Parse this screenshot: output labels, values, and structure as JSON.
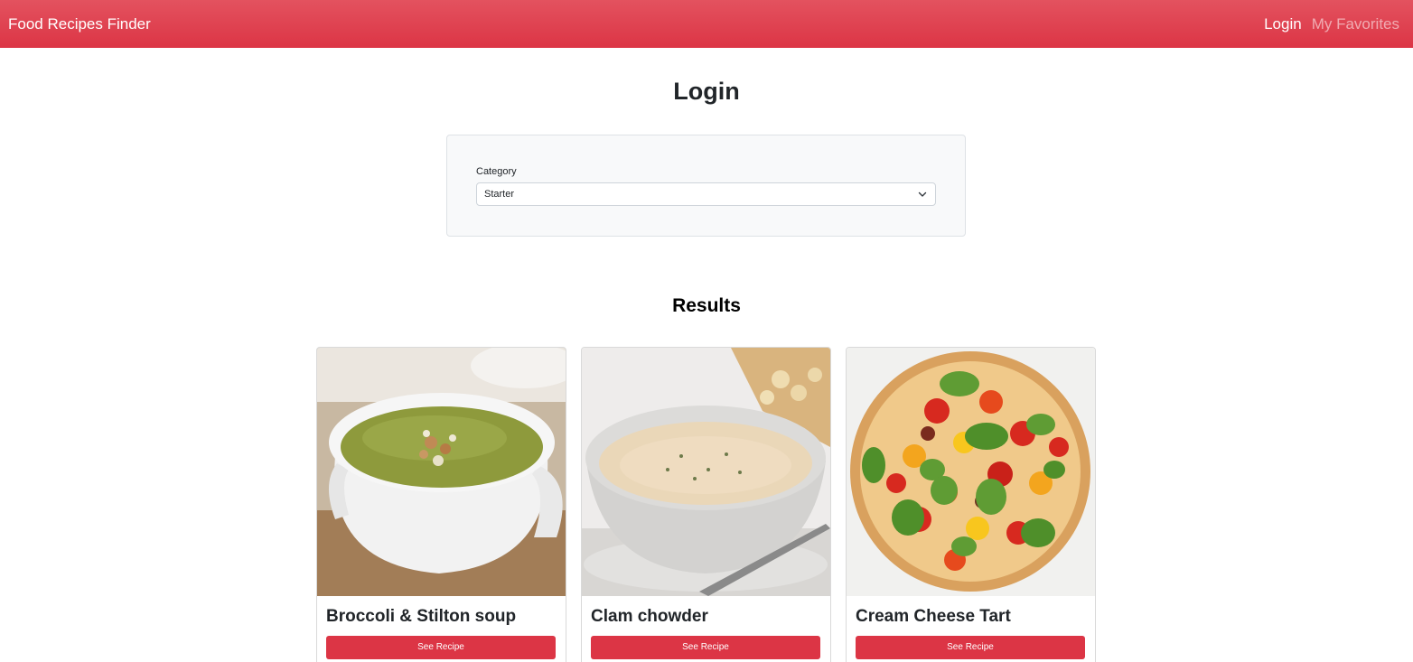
{
  "navbar": {
    "brand": "Food Recipes Finder",
    "links": [
      {
        "label": "Login",
        "active": true
      },
      {
        "label": "My Favorites",
        "active": false
      }
    ],
    "color": "#dc3545"
  },
  "page": {
    "title": "Login",
    "results_title": "Results"
  },
  "filter": {
    "label": "Category",
    "selected": "Starter",
    "icon": "chevron-down-icon"
  },
  "recipes": [
    {
      "title": "Broccoli & Stilton soup",
      "button": "See Recipe",
      "image": "green soup in white bowl"
    },
    {
      "title": "Clam chowder",
      "button": "See Recipe",
      "image": "creamy chowder in white bowl"
    },
    {
      "title": "Cream Cheese Tart",
      "button": "See Recipe",
      "image": "tomato and basil tart"
    }
  ]
}
